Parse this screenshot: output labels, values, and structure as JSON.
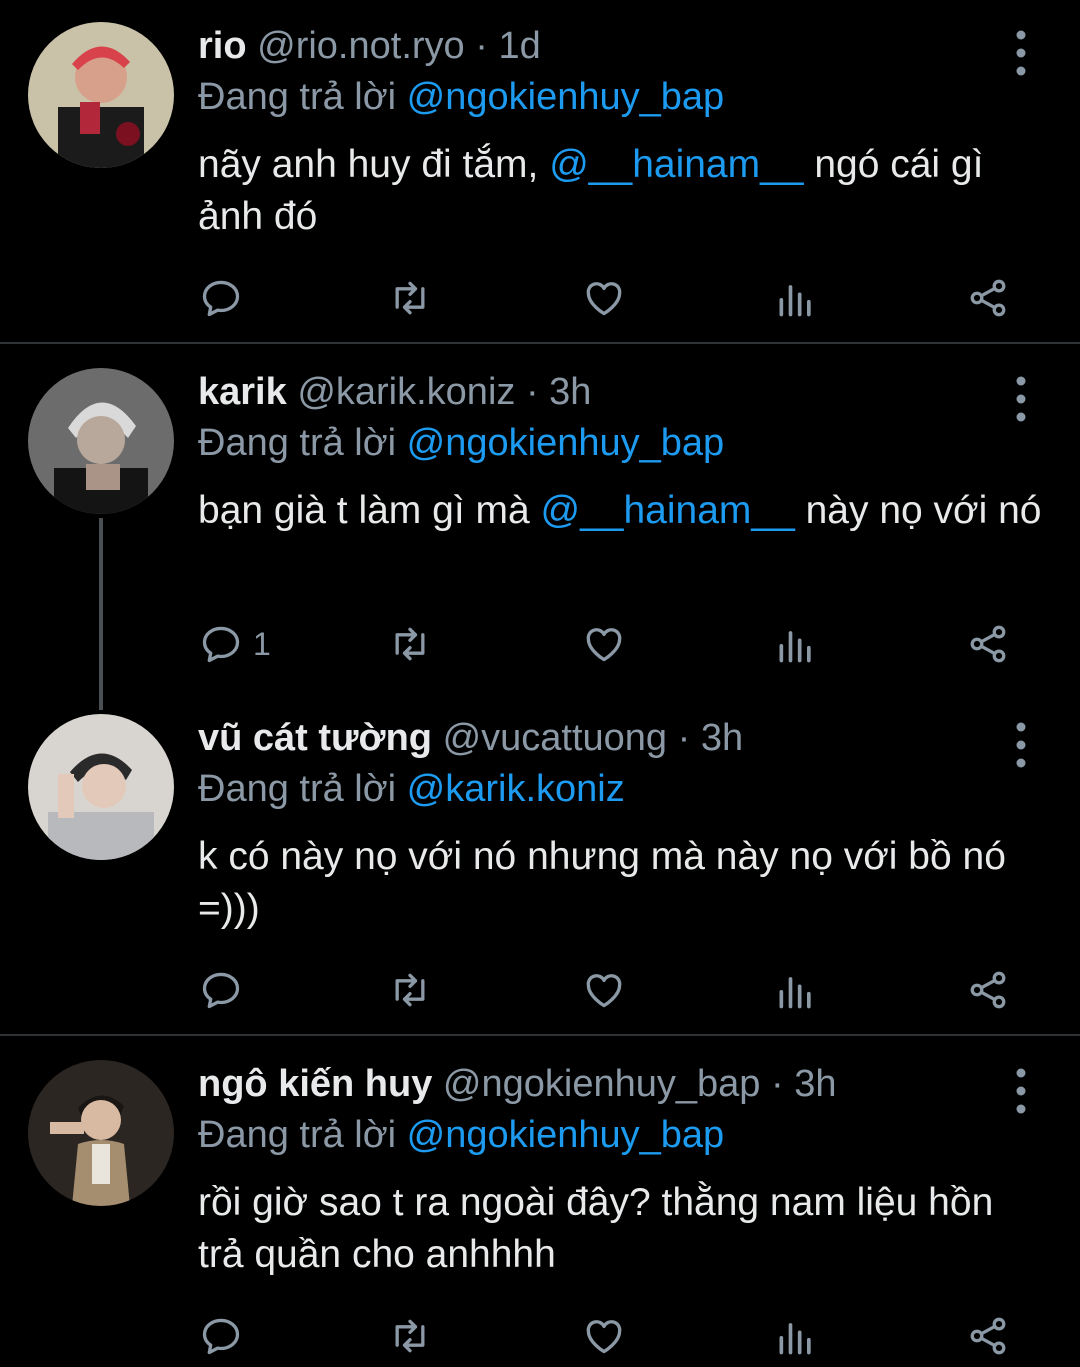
{
  "reply_prefix": "Đang trả lời",
  "tweets": [
    {
      "name": "rio",
      "handle": "@rio.not.ryo",
      "separator": "·",
      "time": "1d",
      "reply_to": "@ngokienhuy_bap",
      "text_before": "nãy anh huy đi tắm, ",
      "mention": "@__hainam__",
      "text_after": " ngó cái gì ảnh đó",
      "replies": ""
    },
    {
      "name": "karik",
      "handle": "@karik.koniz",
      "separator": "·",
      "time": "3h",
      "reply_to": "@ngokienhuy_bap",
      "text_before": "bạn già t làm gì mà ",
      "mention": "@__hainam__",
      "text_after": " này nọ với nó",
      "replies": "1"
    },
    {
      "name": "vũ cát tường",
      "handle": "@vucattuong",
      "separator": "·",
      "time": "3h",
      "reply_to": "@karik.koniz",
      "text_before": "k có này nọ với nó nhưng mà này nọ với bồ nó =)))",
      "mention": "",
      "text_after": "",
      "replies": ""
    },
    {
      "name": "ngô kiến huy",
      "handle": "@ngokienhuy_bap",
      "separator": "·",
      "time": "3h",
      "reply_to": "@ngokienhuy_bap",
      "text_before": "rồi giờ sao t ra ngoài đây? thằng nam liệu hồn trả quần cho anhhhh",
      "mention": "",
      "text_after": "",
      "replies": ""
    }
  ],
  "colors": {
    "background": "#000000",
    "link": "#1d9bf0",
    "muted": "#8b98a5",
    "text": "#e7e9ea",
    "divider": "#2f3336"
  },
  "icons": [
    "reply-icon",
    "retweet-icon",
    "like-icon",
    "analytics-icon",
    "share-icon",
    "more-icon"
  ]
}
